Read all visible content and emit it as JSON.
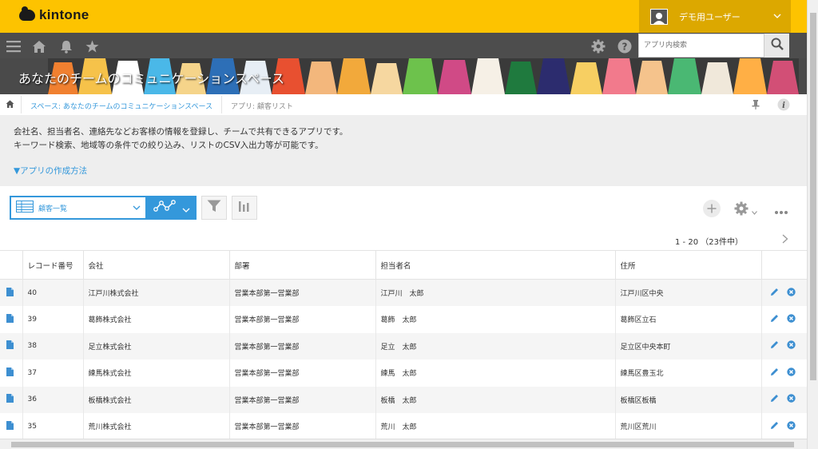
{
  "app": {
    "logo_text": "kintone"
  },
  "header": {
    "username": "デモ用ユーザー"
  },
  "search": {
    "placeholder": "アプリ内検索"
  },
  "banner": {
    "title": "あなたのチームのコミュニケーションスペース"
  },
  "breadcrumb": {
    "space": "スペース: あなたのチームのコミュニケーションスペース",
    "app": "アプリ: 顧客リスト"
  },
  "description": {
    "line1": "会社名、担当者名、連絡先などお客様の情報を登録し、チームで共有できるアプリです。",
    "line2": "キーワード検索、地域等の条件での絞り込み、リストのCSV入出力等が可能です。",
    "link": "▼アプリの作成方法"
  },
  "view": {
    "selected": "顧客一覧"
  },
  "pagination": {
    "text": "1 - 20 （23件中）"
  },
  "table": {
    "headers": [
      "レコード番号",
      "会社",
      "部署",
      "担当者名",
      "住所"
    ],
    "rows": [
      {
        "id": "40",
        "company": "江戸川株式会社",
        "dept": "営業本部第一営業部",
        "person": "江戸川　太郎",
        "address": "江戸川区中央"
      },
      {
        "id": "39",
        "company": "葛飾株式会社",
        "dept": "営業本部第一営業部",
        "person": "葛飾　太郎",
        "address": "葛飾区立石"
      },
      {
        "id": "38",
        "company": "足立株式会社",
        "dept": "営業本部第一営業部",
        "person": "足立　太郎",
        "address": "足立区中央本町"
      },
      {
        "id": "37",
        "company": "練馬株式会社",
        "dept": "営業本部第一営業部",
        "person": "練馬　太郎",
        "address": "練馬区豊玉北"
      },
      {
        "id": "36",
        "company": "板橋株式会社",
        "dept": "営業本部第一営業部",
        "person": "板橋　太郎",
        "address": "板橋区板橋"
      },
      {
        "id": "35",
        "company": "荒川株式会社",
        "dept": "営業本部第一営業部",
        "person": "荒川　太郎",
        "address": "荒川区荒川"
      }
    ]
  },
  "colors": {
    "brand": "#fdc300",
    "nav": "#4d4d4d",
    "accent": "#3498db"
  },
  "icons": [
    "menu-icon",
    "home-icon",
    "bell-icon",
    "star-icon",
    "gear-icon",
    "help-icon",
    "search-icon",
    "filter-icon",
    "graph-icon",
    "plus-icon",
    "more-icon",
    "edit-icon",
    "delete-icon",
    "record-icon"
  ]
}
